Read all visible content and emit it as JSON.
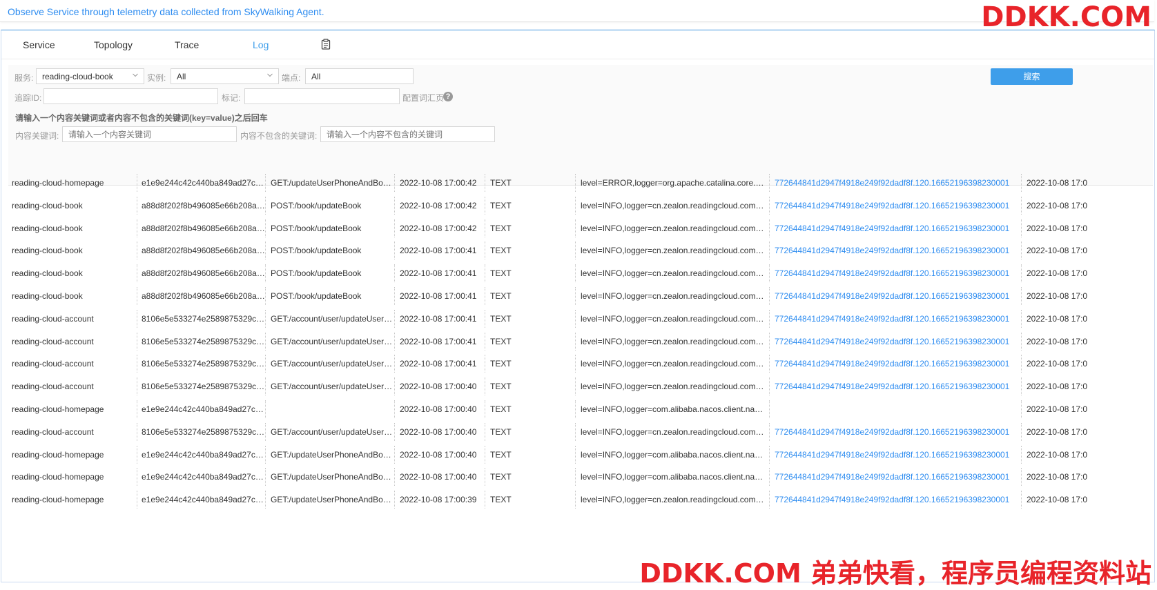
{
  "banner": {
    "text": "Observe Service through telemetry data collected from SkyWalking Agent."
  },
  "watermark": {
    "top": "DDKK.COM",
    "bottom": "DDKK.COM 弟弟快看，程序员编程资料站"
  },
  "tabs": [
    {
      "label": "Service",
      "active": false
    },
    {
      "label": "Topology",
      "active": false
    },
    {
      "label": "Trace",
      "active": false
    },
    {
      "label": "Log",
      "active": true
    }
  ],
  "tab_icon": "clipboard-icon",
  "filters": {
    "service_label": "服务:",
    "service_value": "reading-cloud-book",
    "instance_label": "实例:",
    "instance_value": "All",
    "endpoint_label": "端点:",
    "endpoint_value": "All",
    "trace_label": "追踪ID:",
    "trace_value": "",
    "tag_label": "标记:",
    "tag_value": "",
    "config_label": "配置词汇页",
    "hint": "请输入一个内容关键词或者内容不包含的关键词(key=value)之后回车",
    "keyword_label": "内容关键词:",
    "keyword_placeholder": "请输入一个内容关键词",
    "exclude_label": "内容不包含的关键词:",
    "exclude_placeholder": "请输入一个内容不包含的关键词",
    "search_button": "搜索"
  },
  "colors": {
    "accent": "#3e9eea",
    "link": "#2d8cf0",
    "watermark": "#e8242a"
  },
  "logs": [
    {
      "service": "reading-cloud-homepage",
      "instance": "e1e9e244c42c440ba849ad27c9...",
      "endpoint": "GET:/updateUserPhoneAndBook...",
      "time": "2022-10-08 17:00:42",
      "type": "TEXT",
      "content": "level=ERROR,logger=org.apache.catalina.core.Con...",
      "trace": "772644841d2947f4918e249f92dadf8f.120.16652196398230001",
      "time2": "2022-10-08 17:0"
    },
    {
      "service": "reading-cloud-book",
      "instance": "a88d8f202f8b496085e66b208ab...",
      "endpoint": "POST:/book/updateBook",
      "time": "2022-10-08 17:00:42",
      "type": "TEXT",
      "content": "level=INFO,logger=cn.zealon.readingcloud.commo...",
      "trace": "772644841d2947f4918e249f92dadf8f.120.16652196398230001",
      "time2": "2022-10-08 17:0"
    },
    {
      "service": "reading-cloud-book",
      "instance": "a88d8f202f8b496085e66b208ab...",
      "endpoint": "POST:/book/updateBook",
      "time": "2022-10-08 17:00:42",
      "type": "TEXT",
      "content": "level=INFO,logger=cn.zealon.readingcloud.commo...",
      "trace": "772644841d2947f4918e249f92dadf8f.120.16652196398230001",
      "time2": "2022-10-08 17:0"
    },
    {
      "service": "reading-cloud-book",
      "instance": "a88d8f202f8b496085e66b208ab...",
      "endpoint": "POST:/book/updateBook",
      "time": "2022-10-08 17:00:41",
      "type": "TEXT",
      "content": "level=INFO,logger=cn.zealon.readingcloud.commo...",
      "trace": "772644841d2947f4918e249f92dadf8f.120.16652196398230001",
      "time2": "2022-10-08 17:0"
    },
    {
      "service": "reading-cloud-book",
      "instance": "a88d8f202f8b496085e66b208ab...",
      "endpoint": "POST:/book/updateBook",
      "time": "2022-10-08 17:00:41",
      "type": "TEXT",
      "content": "level=INFO,logger=cn.zealon.readingcloud.commo...",
      "trace": "772644841d2947f4918e249f92dadf8f.120.16652196398230001",
      "time2": "2022-10-08 17:0"
    },
    {
      "service": "reading-cloud-book",
      "instance": "a88d8f202f8b496085e66b208ab...",
      "endpoint": "POST:/book/updateBook",
      "time": "2022-10-08 17:00:41",
      "type": "TEXT",
      "content": "level=INFO,logger=cn.zealon.readingcloud.commo...",
      "trace": "772644841d2947f4918e249f92dadf8f.120.16652196398230001",
      "time2": "2022-10-08 17:0"
    },
    {
      "service": "reading-cloud-account",
      "instance": "8106e5e533274e2589875329cf...",
      "endpoint": "GET:/account/user/updateUserP...",
      "time": "2022-10-08 17:00:41",
      "type": "TEXT",
      "content": "level=INFO,logger=cn.zealon.readingcloud.commo...",
      "trace": "772644841d2947f4918e249f92dadf8f.120.16652196398230001",
      "time2": "2022-10-08 17:0"
    },
    {
      "service": "reading-cloud-account",
      "instance": "8106e5e533274e2589875329cf...",
      "endpoint": "GET:/account/user/updateUserP...",
      "time": "2022-10-08 17:00:41",
      "type": "TEXT",
      "content": "level=INFO,logger=cn.zealon.readingcloud.commo...",
      "trace": "772644841d2947f4918e249f92dadf8f.120.16652196398230001",
      "time2": "2022-10-08 17:0"
    },
    {
      "service": "reading-cloud-account",
      "instance": "8106e5e533274e2589875329cf...",
      "endpoint": "GET:/account/user/updateUserP...",
      "time": "2022-10-08 17:00:41",
      "type": "TEXT",
      "content": "level=INFO,logger=cn.zealon.readingcloud.commo...",
      "trace": "772644841d2947f4918e249f92dadf8f.120.16652196398230001",
      "time2": "2022-10-08 17:0"
    },
    {
      "service": "reading-cloud-account",
      "instance": "8106e5e533274e2589875329cf...",
      "endpoint": "GET:/account/user/updateUserP...",
      "time": "2022-10-08 17:00:40",
      "type": "TEXT",
      "content": "level=INFO,logger=cn.zealon.readingcloud.commo...",
      "trace": "772644841d2947f4918e249f92dadf8f.120.16652196398230001",
      "time2": "2022-10-08 17:0"
    },
    {
      "service": "reading-cloud-homepage",
      "instance": "e1e9e244c42c440ba849ad27c9...",
      "endpoint": "",
      "time": "2022-10-08 17:00:40",
      "type": "TEXT",
      "content": "level=INFO,logger=com.alibaba.nacos.client.namin...",
      "trace": "",
      "time2": "2022-10-08 17:0"
    },
    {
      "service": "reading-cloud-account",
      "instance": "8106e5e533274e2589875329cf...",
      "endpoint": "GET:/account/user/updateUserP...",
      "time": "2022-10-08 17:00:40",
      "type": "TEXT",
      "content": "level=INFO,logger=cn.zealon.readingcloud.commo...",
      "trace": "772644841d2947f4918e249f92dadf8f.120.16652196398230001",
      "time2": "2022-10-08 17:0"
    },
    {
      "service": "reading-cloud-homepage",
      "instance": "e1e9e244c42c440ba849ad27c9...",
      "endpoint": "GET:/updateUserPhoneAndBook...",
      "time": "2022-10-08 17:00:40",
      "type": "TEXT",
      "content": "level=INFO,logger=com.alibaba.nacos.client.namin...",
      "trace": "772644841d2947f4918e249f92dadf8f.120.16652196398230001",
      "time2": "2022-10-08 17:0"
    },
    {
      "service": "reading-cloud-homepage",
      "instance": "e1e9e244c42c440ba849ad27c9...",
      "endpoint": "GET:/updateUserPhoneAndBook...",
      "time": "2022-10-08 17:00:40",
      "type": "TEXT",
      "content": "level=INFO,logger=com.alibaba.nacos.client.namin...",
      "trace": "772644841d2947f4918e249f92dadf8f.120.16652196398230001",
      "time2": "2022-10-08 17:0"
    },
    {
      "service": "reading-cloud-homepage",
      "instance": "e1e9e244c42c440ba849ad27c9...",
      "endpoint": "GET:/updateUserPhoneAndBook...",
      "time": "2022-10-08 17:00:39",
      "type": "TEXT",
      "content": "level=INFO,logger=cn.zealon.readingcloud.commo...",
      "trace": "772644841d2947f4918e249f92dadf8f.120.16652196398230001",
      "time2": "2022-10-08 17:0"
    }
  ]
}
